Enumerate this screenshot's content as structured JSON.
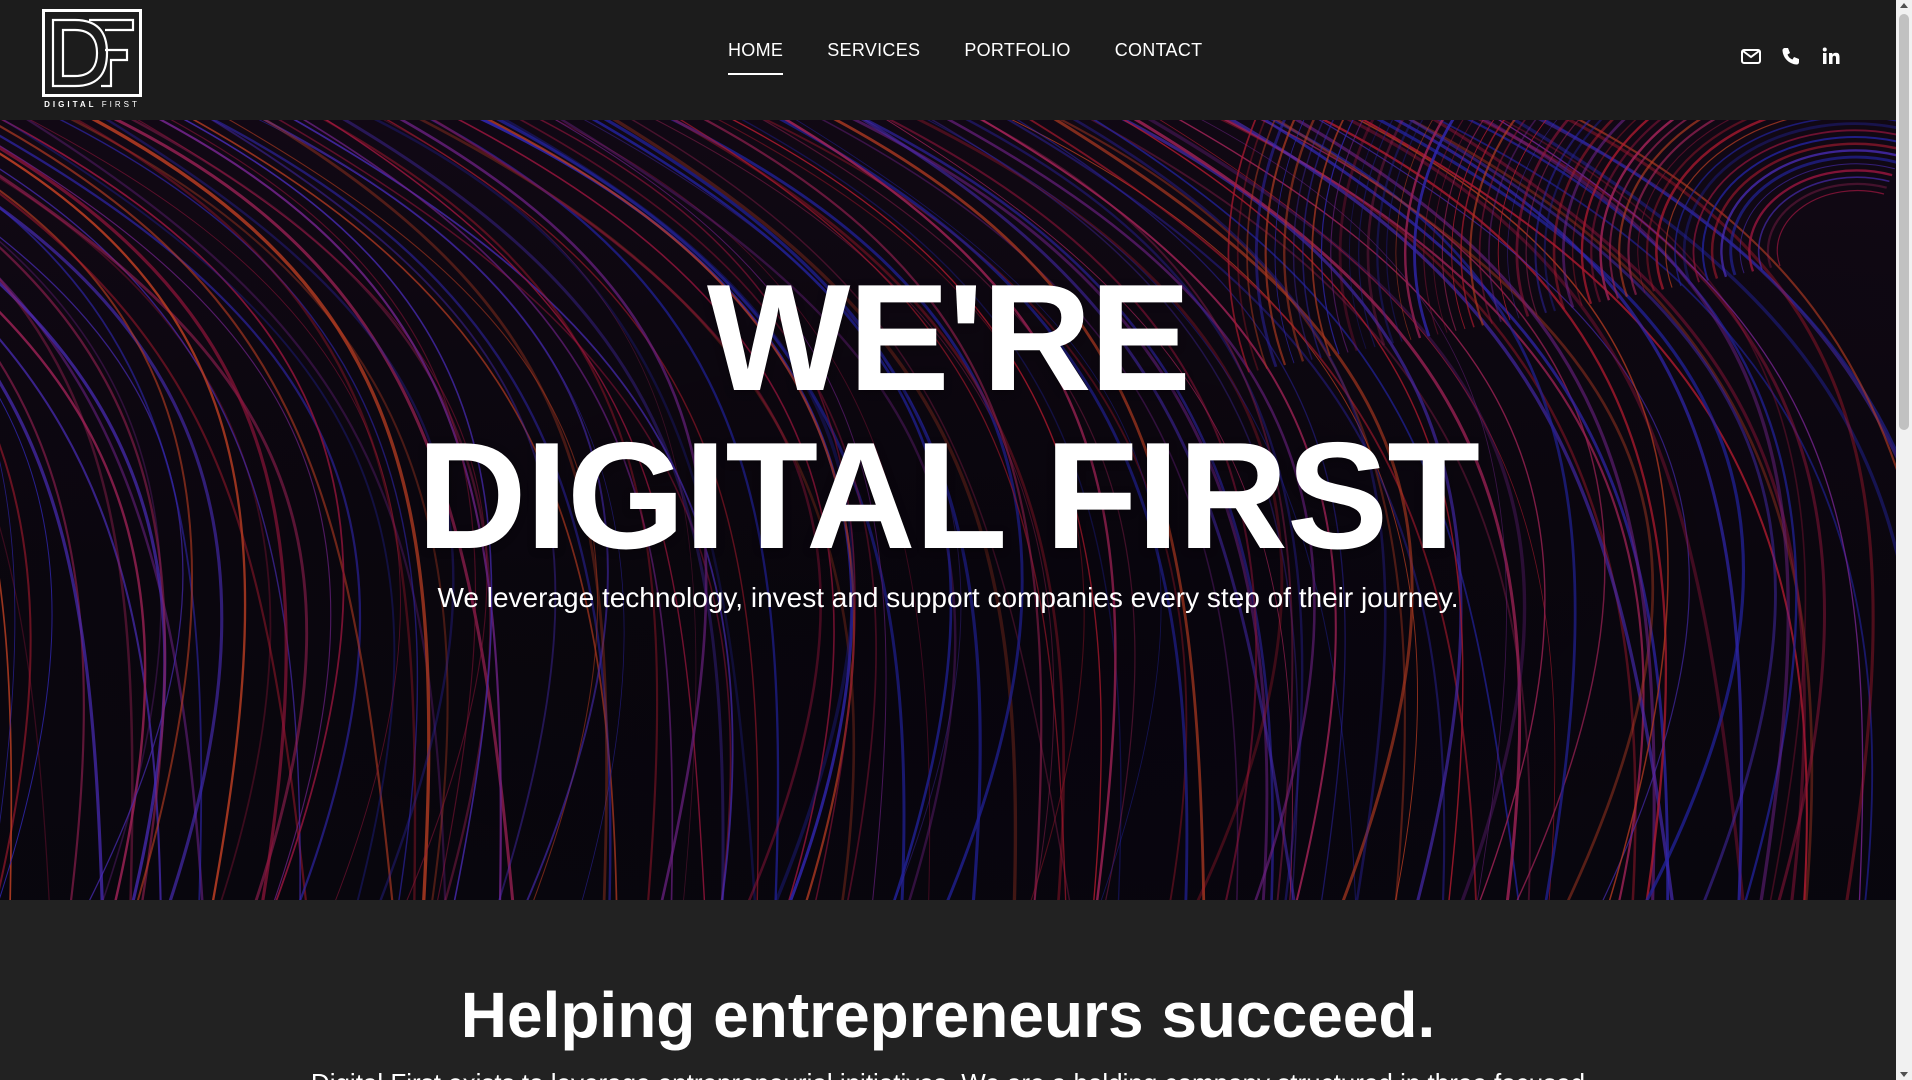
{
  "brand": {
    "logo_monogram": "DF",
    "logo_text_bold": "DIGITAL",
    "logo_text_light": "FIRST"
  },
  "nav": {
    "items": [
      {
        "label": "HOME",
        "active": true
      },
      {
        "label": "SERVICES",
        "active": false
      },
      {
        "label": "PORTFOLIO",
        "active": false
      },
      {
        "label": "CONTACT",
        "active": false
      }
    ]
  },
  "header_icons": [
    "envelope-icon",
    "phone-icon",
    "linkedin-icon"
  ],
  "hero": {
    "title_line1": "WE'RE",
    "title_line2": "DIGITAL FIRST",
    "subtitle": "We leverage technology, invest and support companies every step of their journey."
  },
  "section": {
    "title": "Helping entrepreneurs succeed.",
    "body": "Digital First exists to leverage entrepreneurial initiatives. We are a holding company structured in three focused"
  },
  "colors": {
    "header_bg": "#1c1c1c",
    "section_bg": "#222222",
    "streak_red": "#d8203a",
    "streak_blue": "#3b2fd6"
  }
}
